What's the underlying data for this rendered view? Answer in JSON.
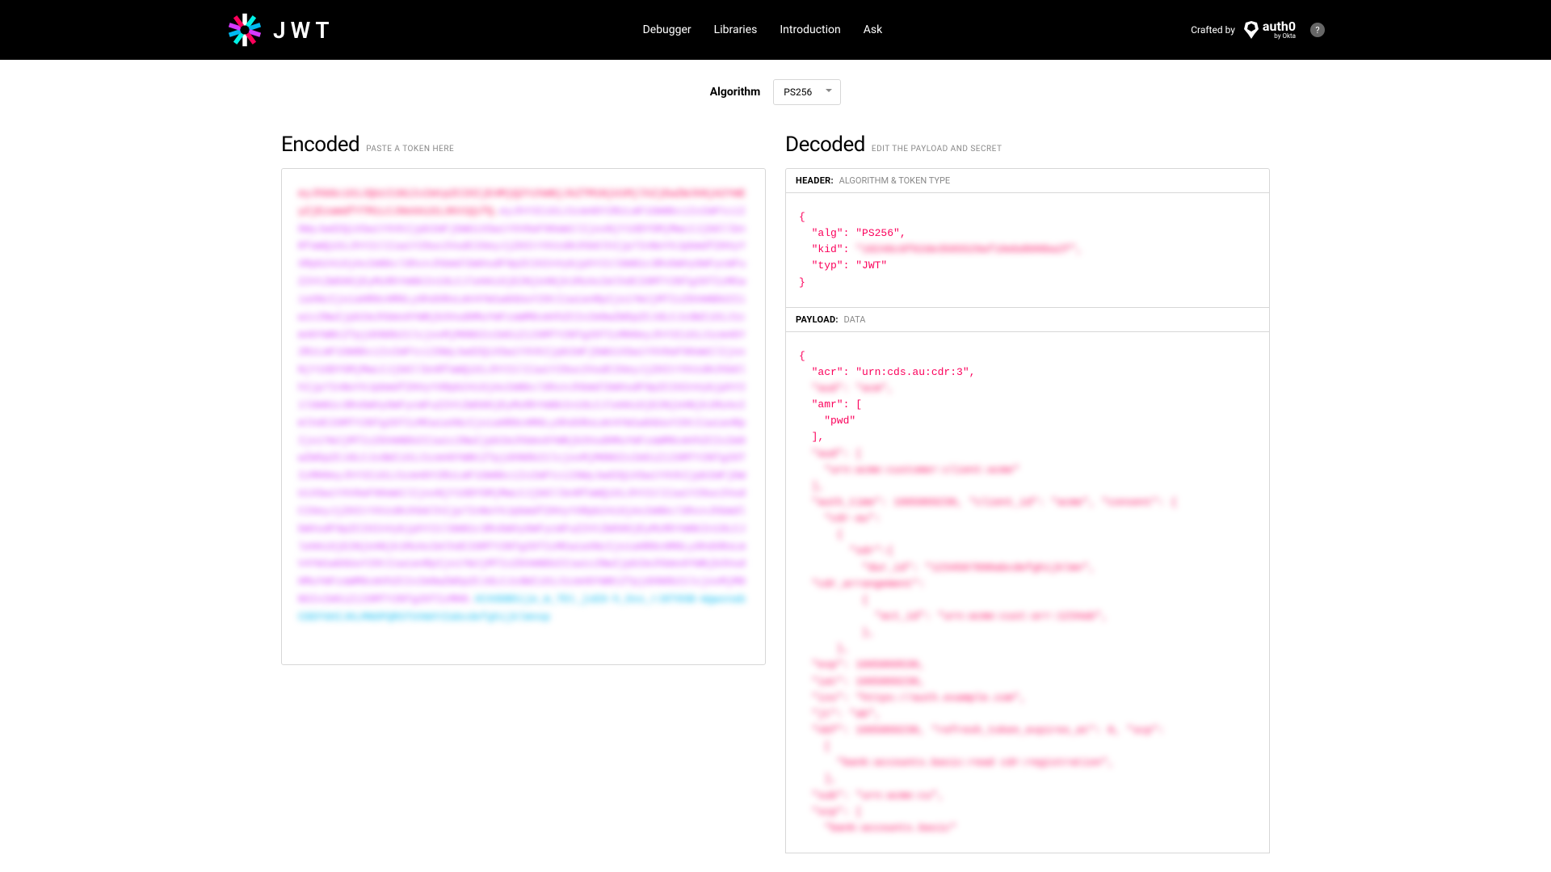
{
  "header": {
    "jwt_text": "JWT",
    "nav": [
      "Debugger",
      "Libraries",
      "Introduction",
      "Ask"
    ],
    "crafted_label": "Crafted by",
    "auth0_label": "auth0",
    "auth0_sub": "by Okta",
    "help": "?"
  },
  "algo": {
    "label": "Algorithm",
    "selected": "PS256"
  },
  "encoded": {
    "title": "Encoded",
    "sub": "PASTE A TOKEN HERE",
    "header_segment": "eyJhbGciOiJQUzI1NiIsImtpZCI6IjE4MjQ2YzhmNjJkZTM1NjU1MjlhZjEwZWJkNjA2YmEyZjEzamdfYTMiLCJ0eXAiOiJKV1QifQ.",
    "payload_segment": "eyJhY3IiOiJ1cm46Y2RzLmF1OmNkciIsImFtciI6WyJwd2QiXSwiYXVkIjpbImFjbWUiXSwiYXV0aF90aW1lIjoxNjY1ODY5MjMwLCJjbGllbnRfaWQiOiJhY21lIiwiY29uc2VudCI6eyJjZHItYXVzdHJhbGlhIjp7InNoYXJpbmdfZHVyYXRpb24iOjAsImNkcl9hcnJhbmdlbWVudF9pZCI6InVybjphY21lOmN1c3RvbWVyOmFycmFuZ2VtZW50OjEyMzRhYmNkIn19LCJleHAiOjE2NjU4Njk1MzAsImlhdCI6MTY2NTg2OTIzMCwiaXNzIjoiaHR0cHM6Ly9hdXRoLmV4YW1wbGUuY29tIiwianRpIjoiYWJjMTIzZGVmNDU2Iiwic2NwIjpbImJhbms6YWNjb3VudHMuYmFzaWM6cmVhZCIsIm9wZW5pZCJdLCJzdWIiOiJ1cm46YWNtZTpjdXN0b21lcjoxMjM0NSIsIm5iZiI6MTY2NTg2OTIzMH0eyJhY3IiOiJ1cm46Y2RzLmF1OmNkciIsImFtciI6WyJwd2QiXSwiYXVkIjpbImFjbWUiXSwiYXV0aF90aW1lIjoxNjY1ODY5MjMwLCJjbGllbnRfaWQiOiJhY21lIiwiY29uc2VudCI6eyJjZHItYXVzdHJhbGlhIjp7InNoYXJpbmdfZHVyYXRpb24iOjAsImNkcl9hcnJhbmdlbWVudF9pZCI6InVybjphY21lOmN1c3RvbWVyOmFycmFuZ2VtZW50OjEyMzRhYmNkIn19LCJleHAiOjE2NjU4Njk1MzAsImlhdCI6MTY2NTg2OTIzMCwiaXNzIjoiaHR0cHM6Ly9hdXRoLmV4YW1wbGUuY29tIiwianRpIjoiYWJjMTIzZGVmNDU2Iiwic2NwIjpbImJhbms6YWNjb3VudHMuYmFzaWM6cmVhZCIsIm9wZW5pZCJdLCJzdWIiOiJ1cm46YWNtZTpjdXN0b21lcjoxMjM0NSIsIm5iZiI6MTY2NTg2OTIzMH0eyJhY3IiOiJ1cm46Y2RzLmF1OmNkciIsImFtciI6WyJwd2QiXSwiYXVkIjpbImFjbWUiXSwiYXV0aF90aW1lIjoxNjY1ODY5MjMwLCJjbGllbnRfaWQiOiJhY21lIiwiY29uc2VudCI6eyJjZHItYXVzdHJhbGlhIjp7InNoYXJpbmdfZHVyYXRpb24iOjAsImNkcl9hcnJhbmdlbWVudF9pZCI6InVybjphY21lOmN1c3RvbWVyOmFycmFuZ2VtZW50OjEyMzRhYmNkIn19LCJleHAiOjE2NjU4Njk1MzAsImlhdCI6MTY2NTg2OTIzMCwiaXNzIjoiaHR0cHM6Ly9hdXRoLmV4YW1wbGUuY29tIiwianRpIjoiYWJjMTIzZGVmNDU2Iiwic2NwIjpbImJhbms6YWNjb3VudHMuYmFzaWM6cmVhZCIsIm9wZW5pZCJdLCJzdWIiOiJ1cm46YWNtZTpjdXN0b21lcjoxMjM0NSIsIm5iZiI6MTY2NTg2OTIzMH0.",
    "sig_segment": "XCXODB5ije_m_TEt_jsE8-h_Oss_rJ8T65B-WgwxnabCDEFGHIJKLMNOPQRSTUVWXYZabcdefghijklmnop"
  },
  "decoded": {
    "title": "Decoded",
    "sub": "EDIT THE PAYLOAD AND SECRET",
    "header_section": {
      "label": "HEADER:",
      "desc": "ALGORITHM & TOKEN TYPE",
      "line_open": "{",
      "line_alg": "  \"alg\": \"PS256\",",
      "line_kid_key": "  \"kid\": ",
      "line_kid_val": "\"18246c8f62de3565529af10ebd606ba2f\",",
      "line_typ": "  \"typ\": \"JWT\"",
      "line_close": "}"
    },
    "payload_section": {
      "label": "PAYLOAD:",
      "desc": "DATA",
      "line_open": "{",
      "line_acr": "  \"acr\": \"urn:cds.au:cdr:3\",",
      "line_blur1": "  \"aud\": \"acm\",",
      "line_amr_open": "  \"amr\": [",
      "line_pwd": "    \"pwd\"",
      "line_amr_close": "  ],",
      "line_blur2": "  \"aud\": [",
      "line_blur3": "    \"urn:acme:customer:client:acme\"",
      "line_blur4": "  ],",
      "line_blur5": "  \"auth_time\": 1665869230, \"client_id\": \"acme\", \"consent\": {",
      "line_blur6": "    \"cdr-au\":",
      "line_blur7": "      {",
      "line_blur8": "        \"sdr\":{",
      "line_blur9": "          \"dur_id\": \"1234567890abcdefghijklmn\",",
      "line_blur10": "  \"cdr_arrangement\":",
      "line_blur11": "          {",
      "line_blur12": "            \"act_id\": \"urn:acme:cust:arr:1234ab\",",
      "line_blur13": "          },",
      "line_blur14": "      },",
      "line_blur15": "  \"exp\": 1665869530,",
      "line_blur16": "  \"iat\": 1665869230,",
      "line_blur17": "  \"iss\": \"https://auth.example.com\",",
      "line_blur18": "  \"jt\": \"ab\",",
      "line_blur19": "  \"nbf\": 1665869230, \"refresh_token_expires_at\": 0, \"scp\":",
      "line_blur20": "    [",
      "line_blur21": "      \"bank:accounts.basic:read cdr:registration\",",
      "line_blur22": "    ],",
      "line_blur23": "  \"sub\": \"urn:acme:cu\",",
      "line_blur24": "  \"scp\": [",
      "line_blur25": "    \"bank:accounts.basic\""
    }
  }
}
